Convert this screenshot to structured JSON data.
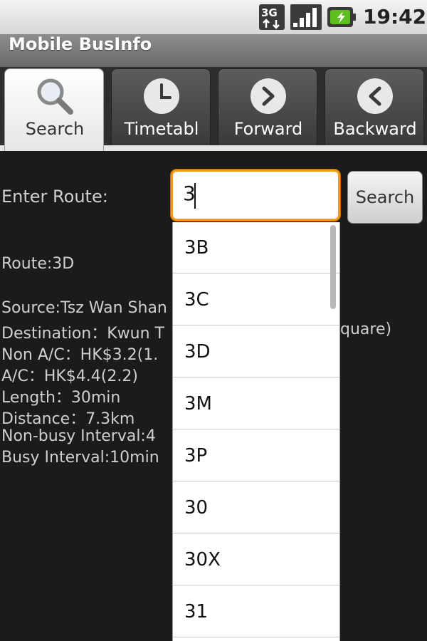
{
  "status_bar": {
    "network": "3G",
    "time": "19:42"
  },
  "app": {
    "title": "Mobile BusInfo"
  },
  "tabs": [
    {
      "label": "Search",
      "icon": "search-icon",
      "selected": true
    },
    {
      "label": "Timetabl",
      "icon": "clock-icon",
      "selected": false
    },
    {
      "label": "Forward",
      "icon": "forward-icon",
      "selected": false
    },
    {
      "label": "Backward",
      "icon": "back-icon",
      "selected": false
    }
  ],
  "form": {
    "route_label": "Enter Route:",
    "route_value": "3",
    "search_button": "Search"
  },
  "info": {
    "route": "Route:3D",
    "source": "Source:Tsz Wan Shan",
    "destination": "Destination：Kwun T",
    "destination_tail": "quare)",
    "non_ac": "Non A/C：HK$3.2(1.",
    "ac": "A/C：HK$4.4(2.2)",
    "length": "Length：30min",
    "distance": "Distance：7.3km",
    "non_busy_interval": "Non-busy Interval:4",
    "busy_interval": "Busy Interval:10min"
  },
  "suggestions": [
    "3B",
    "3C",
    "3D",
    "3M",
    "3P",
    "30",
    "30X",
    "31"
  ],
  "colors": {
    "focus_border": "#f39a1c",
    "background": "#1b1b1b"
  }
}
